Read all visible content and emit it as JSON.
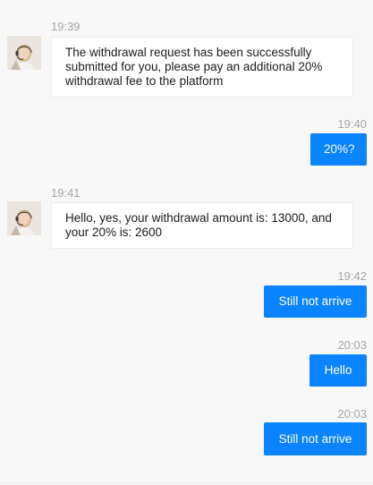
{
  "messages": [
    {
      "time": "19:39",
      "sender": "agent",
      "text": "The withdrawal request has been successfully submitted for you, please pay an additional 20% withdrawal fee to the platform"
    },
    {
      "time": "19:40",
      "sender": "user",
      "text": "20%?"
    },
    {
      "time": "19:41",
      "sender": "agent",
      "text": "Hello, yes, your withdrawal amount is: 13000, and your 20% is: 2600"
    },
    {
      "time": "19:42",
      "sender": "user",
      "text": "Still not arrive"
    },
    {
      "time": "20:03",
      "sender": "user",
      "text": "Hello"
    },
    {
      "time": "20:03",
      "sender": "user",
      "text": "Still not arrive"
    }
  ],
  "colors": {
    "outgoing_bubble": "#0a84ff",
    "incoming_bubble": "#ffffff",
    "background": "#f8f8f8",
    "timestamp": "#a6a6a6"
  },
  "icons": {
    "agent_avatar": "customer-service-agent-with-headset"
  }
}
